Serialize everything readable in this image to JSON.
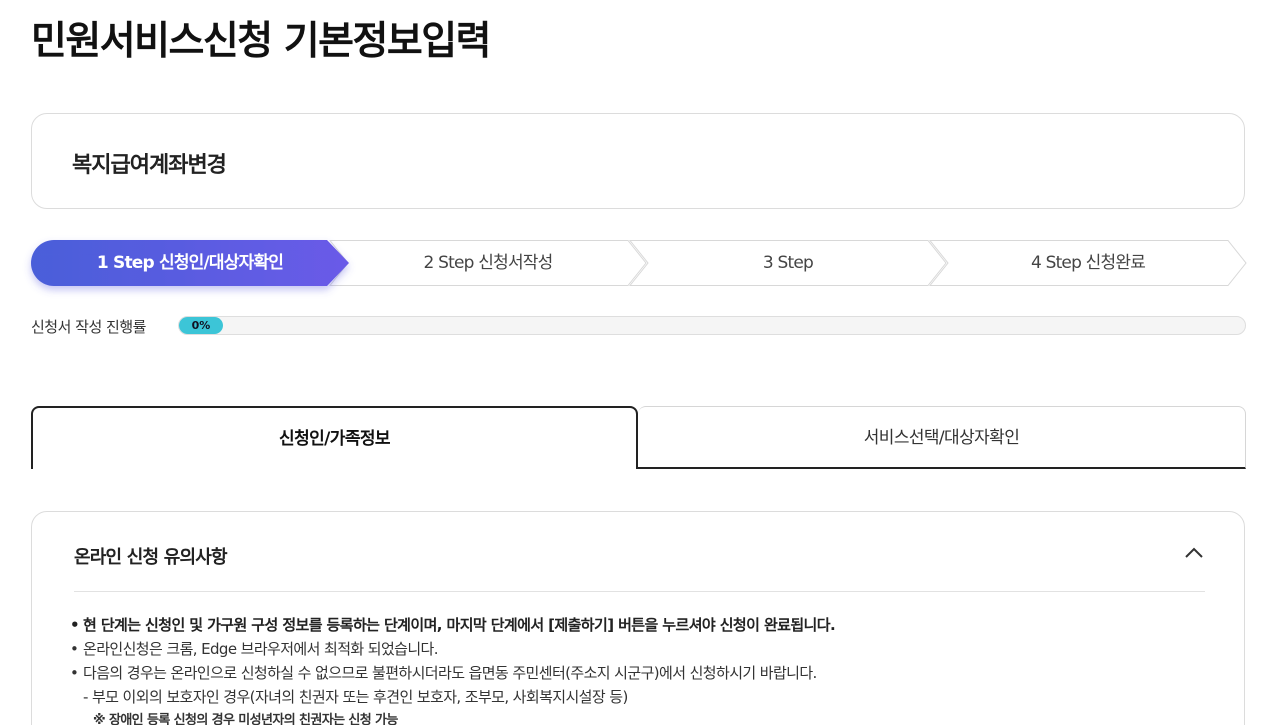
{
  "page": {
    "title": "민원서비스신청 기본정보입력"
  },
  "service": {
    "name": "복지급여계좌변경"
  },
  "steps": [
    {
      "label": "1 Step 신청인/대상자확인",
      "active": true
    },
    {
      "label": "2 Step 신청서작성",
      "active": false
    },
    {
      "label": "3 Step",
      "active": false
    },
    {
      "label": "4 Step 신청완료",
      "active": false
    }
  ],
  "progress": {
    "label": "신청서 작성 진행률",
    "value_text": "0%",
    "value": 0
  },
  "tabs": [
    {
      "label": "신청인/가족정보",
      "active": true
    },
    {
      "label": "서비스선택/대상자확인",
      "active": false
    }
  ],
  "notice": {
    "title": "온라인 신청 유의사항",
    "items": [
      "현 단계는 신청인 및 가구원 구성 정보를 등록하는 단계이며, 마지막 단계에서 [제출하기] 버튼을 누르셔야 신청이 완료됩니다.",
      "온라인신청은 크롬, Edge 브라우저에서 최적화 되었습니다.",
      "다음의 경우는 온라인으로 신청하실 수 없으므로 불편하시더라도 읍면동 주민센터(주소지 시군구)에서 신청하시기 바랍니다.",
      "- 부모 이외의 보호자인 경우(자녀의 친권자 또는 후견인 보호자, 조부모, 사회복지시설장 등)",
      "※ 장애인 등록 신청의 경우 미성년자의 친권자는 신청 가능"
    ]
  },
  "colors": {
    "step_active_start": "#4a5ed9",
    "step_active_end": "#6a5ae8",
    "progress_fill": "#3cc5d7"
  }
}
